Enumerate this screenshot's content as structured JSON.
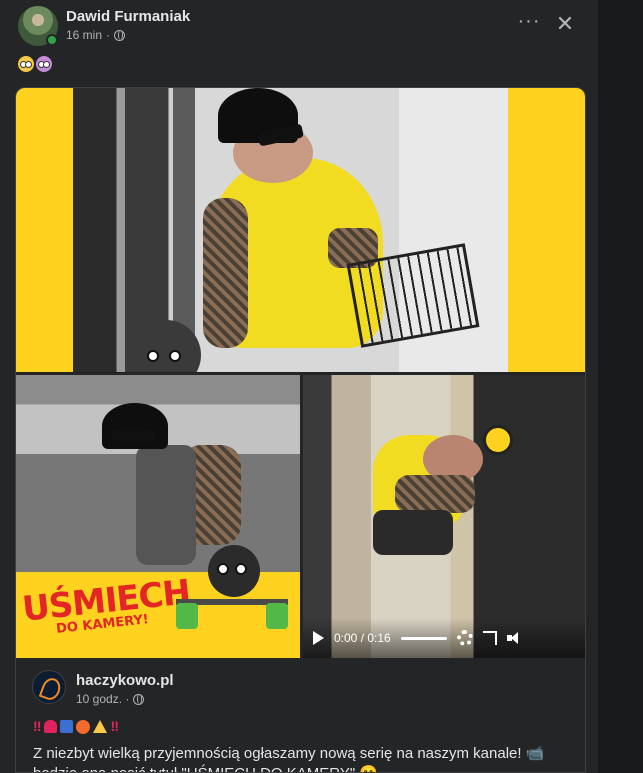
{
  "post": {
    "author": "Dawid Furmaniak",
    "time": "16 min",
    "privacy_icon": "globe-icon",
    "emojis": [
      "flushed-face",
      "exploding-head"
    ],
    "more_label": "···",
    "close_label": "✕"
  },
  "shared": {
    "media": {
      "logo_text": "UŚMIECH",
      "logo_subtext": "DO KAMERY!",
      "video": {
        "time": "0:00 / 0:16",
        "progress": 0
      }
    },
    "page_name": "haczykowo.pl",
    "time": "10 godz. ·",
    "emoji_row": [
      "‼",
      "siren",
      "police-officer",
      "angry-face",
      "warning",
      "‼"
    ],
    "bang": "‼",
    "text_line1": "Z niezbyt wielką przyjemnością ogłaszamy nową serię na naszym kanale! 📹",
    "text_line2": "będzie ona nosić tytuł \"UŚMIECH DO KAMERY\" 😁"
  },
  "colors": {
    "background": "#242526",
    "frame_yellow": "#ffd21f",
    "logo_red": "#e42526",
    "online_green": "#31a24c"
  }
}
